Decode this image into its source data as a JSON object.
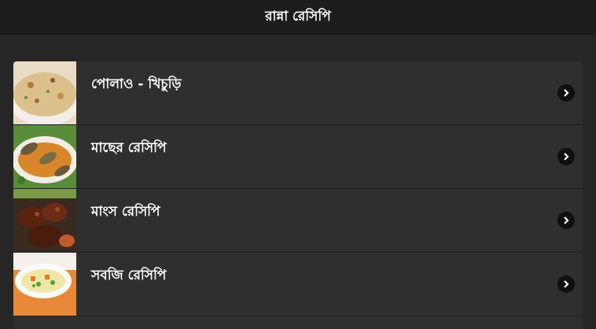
{
  "header": {
    "title": "রান্না রেসিপি"
  },
  "list": {
    "items": [
      {
        "label": "পোলাও - খিচুড়ি",
        "thumbnail_icon": "pulao-khichuri-thumbnail"
      },
      {
        "label": "মাছের রেসিপি",
        "thumbnail_icon": "fish-recipe-thumbnail"
      },
      {
        "label": "মাংস রেসিপি",
        "thumbnail_icon": "meat-recipe-thumbnail"
      },
      {
        "label": "সবজি রেসিপি",
        "thumbnail_icon": "vegetable-recipe-thumbnail"
      }
    ],
    "chevron_icon": "chevron-right-icon"
  },
  "colors": {
    "background": "#262626",
    "header": "#1d1d1d",
    "row": "#2f2f2f",
    "text": "#ffffff"
  }
}
